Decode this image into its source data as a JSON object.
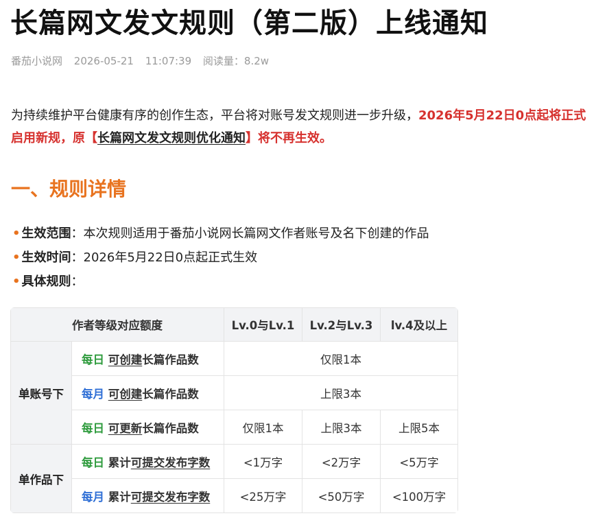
{
  "article": {
    "title": "长篇网文发文规则（第二版）上线通知",
    "meta": {
      "source": "番茄小说网",
      "date": "2026-05-21",
      "time": "11:07:39",
      "reads": "阅读量：8.2w"
    },
    "intro": {
      "text": "为持续维护平台健康有序的创作生态，平台将对账号发文规则进一步升级，",
      "highlight_1": "2026年5月22日0点起将正式启用新规，原【",
      "link": "长篇网文发文规则优化通知",
      "highlight_2": "】将不再生效。"
    },
    "section_heading": "一、规则详情",
    "bullets": [
      {
        "key": "生效范围",
        "text": "：本次规则适用于番茄小说网长篇网文作者账号及名下创建的作品"
      },
      {
        "key": "生效时间",
        "text": "：2026年5月22日0点起正式生效"
      },
      {
        "key": "具体规则",
        "text": "："
      }
    ],
    "table": {
      "headers": [
        "作者等级对应额度",
        "Lv.0与Lv.1",
        "Lv.2与Lv.3",
        "lv.4及以上"
      ],
      "groups": [
        "单账号下",
        "单作品下"
      ],
      "rows": [
        {
          "period": "每日",
          "prefix": "",
          "action": "可创建",
          "suffix": "长篇作品数",
          "merged": "仅限1本"
        },
        {
          "period": "每月",
          "prefix": "",
          "action": "可创建",
          "suffix": "长篇作品数",
          "merged": "上限3本"
        },
        {
          "period": "每日",
          "prefix": "",
          "action": "可更新",
          "suffix": "长篇作品数",
          "values": [
            "仅限1本",
            "上限3本",
            "上限5本"
          ]
        },
        {
          "period": "每日",
          "prefix": "累计",
          "action": "可提交发布字数",
          "suffix": "",
          "values": [
            "<1万字",
            "<2万字",
            "<5万字"
          ]
        },
        {
          "period": "每月",
          "prefix": "累计",
          "action": "可提交发布字数",
          "suffix": "",
          "values": [
            "<25万字",
            "<50万字",
            "<100万字"
          ]
        }
      ]
    },
    "colors": {
      "accent_orange": "#e8731f",
      "highlight_red": "#d6312e",
      "daily_green": "#2e9b3d",
      "monthly_blue": "#2f6fd6"
    }
  }
}
